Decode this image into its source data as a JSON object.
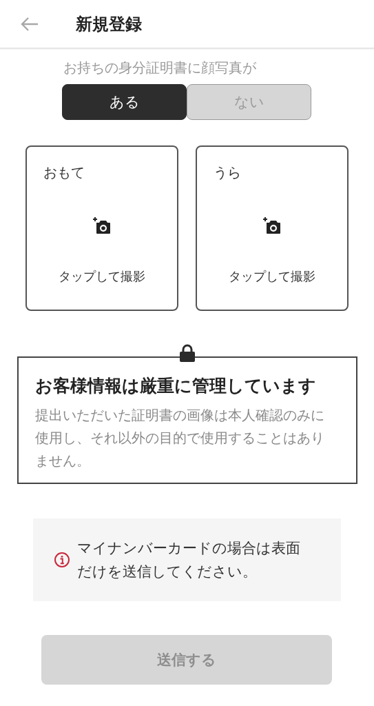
{
  "header": {
    "title": "新規登録"
  },
  "question": "お持ちの身分証明書に顔写真が",
  "options": [
    {
      "label": "ある",
      "selected": true
    },
    {
      "label": "ない",
      "selected": false
    }
  ],
  "photo_slots": [
    {
      "label": "おもて",
      "caption": "タップして撮影"
    },
    {
      "label": "うら",
      "caption": "タップして撮影"
    }
  ],
  "security": {
    "title": "お客様情報は厳重に管理しています",
    "body": "提出いただいた証明書の画像は本人確認のみに使用し、それ以外の目的で使用することはありません。"
  },
  "notice": {
    "text": "マイナンバーカードの場合は表面だけを送信してください。"
  },
  "submit": {
    "label": "送信する",
    "disabled": true
  }
}
